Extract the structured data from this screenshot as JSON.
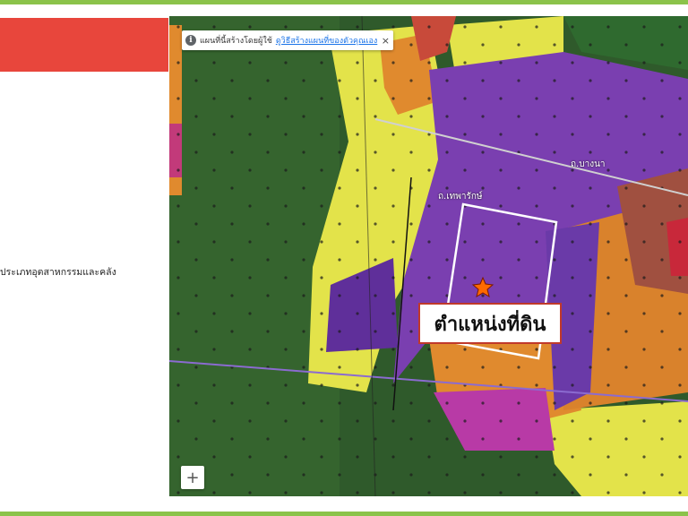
{
  "left_panel": {
    "header_color": "#e8463c",
    "category_text": "ประเภทอุตสาหกรรมและคลัง"
  },
  "map": {
    "notice": {
      "text": "แผนที่นี้สร้างโดยผู้ใช้",
      "link": "ดูวิธีสร้างแผนที่ของตัวคุณเอง",
      "close": "×",
      "icon": "info-icon"
    },
    "land_label": "ตำแหน่งที่ดิน",
    "marker_icon": "star-marker-icon",
    "zoom_in": "+",
    "road_labels": [
      "ถ.บางนา",
      "ถ.เทพารักษ์"
    ],
    "zone_colors": {
      "agricultural": "#2f5a2b",
      "low_density_residential": "#e3e34a",
      "medium_density_residential": "#e08a2e",
      "industrial": "#7a3fb0",
      "commercial": "#c84a3a",
      "government": "#b83aa6"
    }
  }
}
